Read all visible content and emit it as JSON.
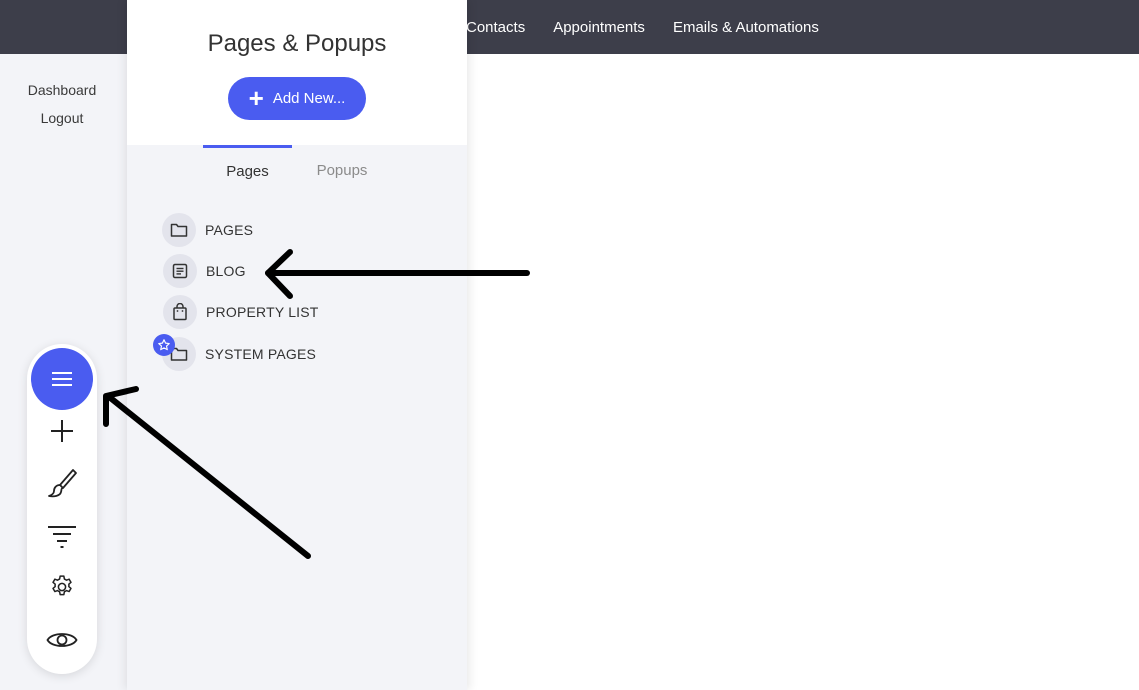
{
  "topnav": {
    "items": [
      "Contacts",
      "Appointments",
      "Emails & Automations"
    ]
  },
  "sidebar": {
    "dashboard": "Dashboard",
    "logout": "Logout"
  },
  "panel": {
    "title": "Pages & Popups",
    "add_button": "Add New...",
    "tabs": [
      {
        "label": "Pages",
        "active": true
      },
      {
        "label": "Popups",
        "active": false
      }
    ],
    "items": [
      {
        "label": "PAGES",
        "icon": "folder-icon"
      },
      {
        "label": "BLOG",
        "icon": "article-icon"
      },
      {
        "label": "PROPERTY LIST",
        "icon": "shopping-bag-icon"
      },
      {
        "label": "SYSTEM PAGES",
        "icon": "folder-icon",
        "badge": "star-icon"
      }
    ]
  },
  "toolbar": {
    "tools": [
      "menu-icon",
      "plus-icon",
      "brush-icon",
      "filter-icon",
      "gear-icon",
      "eye-icon"
    ]
  },
  "colors": {
    "accent": "#4a5cf0",
    "topbar": "#3d3e4a",
    "panel_bg": "#f3f4f8"
  }
}
